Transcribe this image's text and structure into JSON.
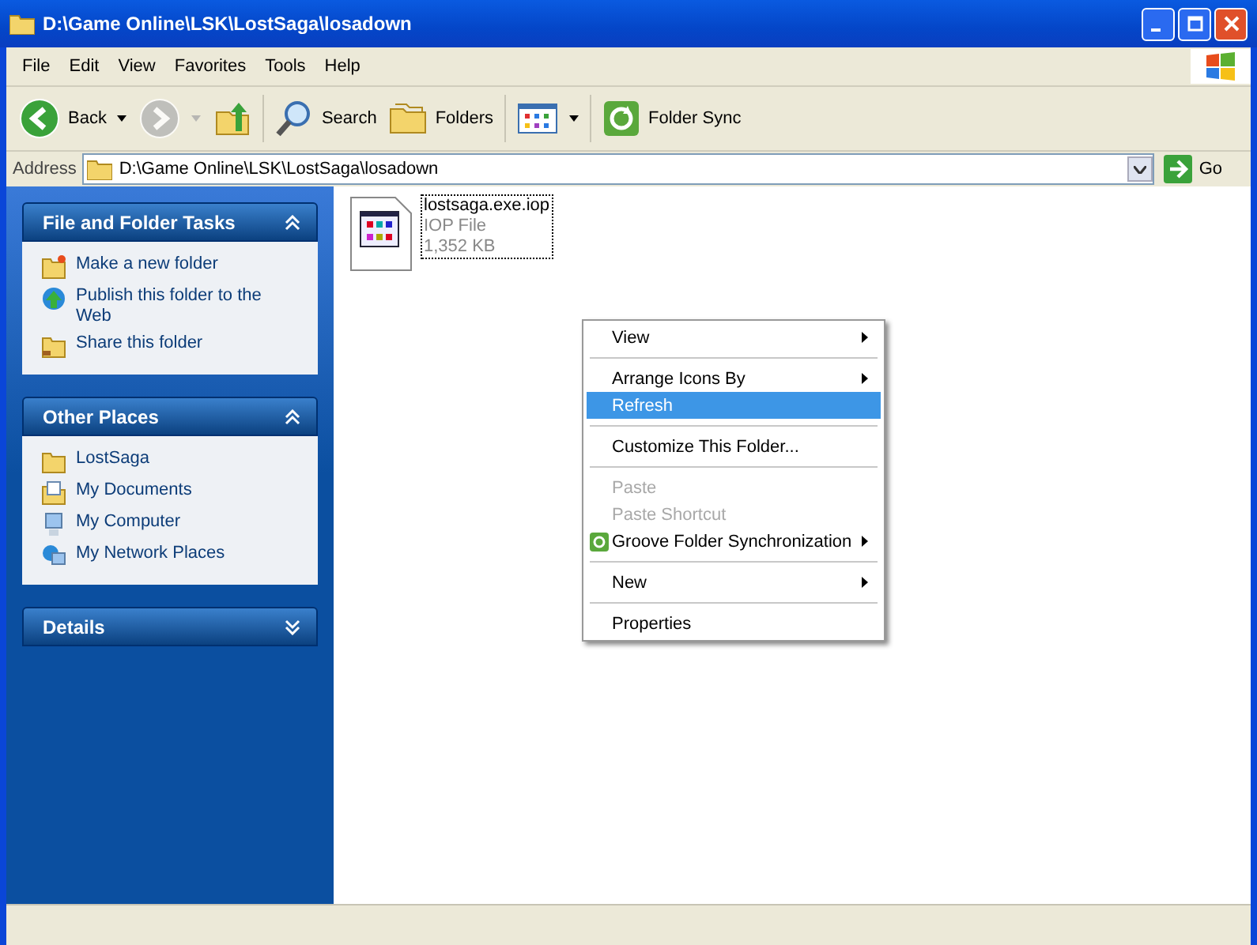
{
  "window": {
    "title": "D:\\Game Online\\LSK\\LostSaga\\losadown"
  },
  "menu_bar": [
    "File",
    "Edit",
    "View",
    "Favorites",
    "Tools",
    "Help"
  ],
  "toolbar": [
    {
      "kind": "back",
      "label": "Back",
      "disabled": false
    },
    {
      "kind": "forward",
      "disabled": true
    },
    {
      "kind": "up",
      "disabled": false
    },
    {
      "kind": "search",
      "label": "Search",
      "disabled": false
    },
    {
      "kind": "folders",
      "label": "Folders",
      "disabled": false
    },
    {
      "kind": "views",
      "disabled": false
    },
    {
      "kind": "sync",
      "label": "Folder Sync",
      "disabled": false
    }
  ],
  "address_bar": {
    "label": "Address",
    "value": "D:\\Game Online\\LSK\\LostSaga\\losadown",
    "go": "Go"
  },
  "sidebar": [
    {
      "title": "File and Folder Tasks",
      "expanded": true,
      "items": [
        {
          "kind": "new_folder",
          "label": "Make a new folder"
        },
        {
          "kind": "publish",
          "label": "Publish this folder to the Web"
        },
        {
          "kind": "share",
          "label": "Share this folder"
        }
      ]
    },
    {
      "title": "Other Places",
      "expanded": true,
      "items": [
        {
          "kind": "folder",
          "label": "LostSaga"
        },
        {
          "kind": "documents",
          "label": "My Documents"
        },
        {
          "kind": "computer",
          "label": "My Computer"
        },
        {
          "kind": "network",
          "label": "My Network Places"
        }
      ]
    },
    {
      "title": "Details",
      "expanded": false
    }
  ],
  "files": [
    {
      "name": "lostsaga.exe.iop",
      "type": "IOP File",
      "size": "1,352 KB",
      "selected": true
    }
  ],
  "context_menu": [
    {
      "kind": "item",
      "label": "View",
      "submenu": true,
      "disabled": false,
      "selected": false
    },
    {
      "kind": "separator"
    },
    {
      "kind": "item",
      "label": "Arrange Icons By",
      "submenu": true,
      "disabled": false,
      "selected": false
    },
    {
      "kind": "item",
      "label": "Refresh",
      "submenu": false,
      "disabled": false,
      "selected": true
    },
    {
      "kind": "separator"
    },
    {
      "kind": "item",
      "label": "Customize This Folder...",
      "submenu": false,
      "disabled": false,
      "selected": false
    },
    {
      "kind": "separator"
    },
    {
      "kind": "item",
      "label": "Paste",
      "submenu": false,
      "disabled": true,
      "selected": false
    },
    {
      "kind": "item",
      "label": "Paste Shortcut",
      "submenu": false,
      "disabled": true,
      "selected": false
    },
    {
      "kind": "icon_item",
      "label": "Groove Folder Synchronization",
      "submenu": true,
      "disabled": false,
      "selected": false
    },
    {
      "kind": "separator"
    },
    {
      "kind": "item",
      "label": "New",
      "submenu": true,
      "disabled": false,
      "selected": false
    },
    {
      "kind": "separator"
    },
    {
      "kind": "item",
      "label": "Properties",
      "submenu": false,
      "disabled": false,
      "selected": false
    }
  ]
}
